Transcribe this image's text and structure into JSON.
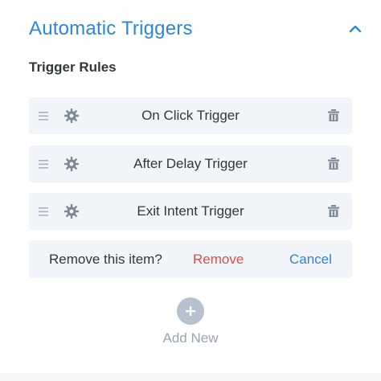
{
  "section": {
    "title": "Automatic Triggers",
    "collapse_icon": "chevron-up-icon"
  },
  "subtitle": "Trigger Rules",
  "rules": [
    {
      "label": "On Click Trigger"
    },
    {
      "label": "After Delay Trigger"
    },
    {
      "label": "Exit Intent Trigger"
    }
  ],
  "confirm": {
    "prompt": "Remove this item?",
    "remove_label": "Remove",
    "cancel_label": "Cancel"
  },
  "add_new": {
    "label": "Add New",
    "icon": "plus-icon"
  },
  "icons": {
    "drag": "drag-handle-icon",
    "settings": "gear-icon",
    "delete": "trash-icon"
  },
  "colors": {
    "accent": "#2b87da",
    "danger": "#e64a4a",
    "row_bg": "#f1f5f9",
    "text": "#32373c",
    "muted": "#9aa5b0",
    "icon": "#7e8b96"
  }
}
